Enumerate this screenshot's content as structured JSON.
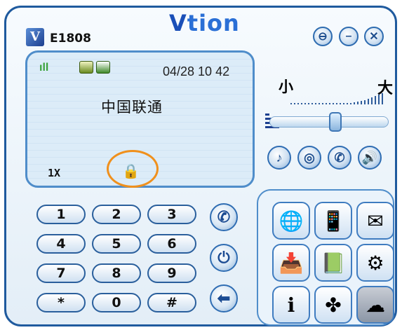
{
  "window": {
    "brand_letter": "V",
    "model": "E1808",
    "logo_prefix": "V",
    "logo_rest": "tion",
    "buttons": {
      "lock": "⊖",
      "minimize": "–",
      "close": "✕"
    }
  },
  "screen": {
    "signal": "ıll",
    "datetime": "04/28 10 42",
    "operator": "中国联通",
    "mode": "1X",
    "lock_glyph": "🔒"
  },
  "volume": {
    "low_label": "小",
    "high_label": "大",
    "level": 0.56
  },
  "function_buttons": [
    "♪",
    "◎",
    "✆",
    "🔊"
  ],
  "keypad": {
    "keys": [
      "1",
      "2",
      "3",
      "4",
      "5",
      "6",
      "7",
      "8",
      "9",
      "*",
      "0",
      "#"
    ]
  },
  "side_buttons": {
    "call": "✆",
    "power": "⏻",
    "back": "⬅"
  },
  "apps": [
    {
      "name": "browser-icon",
      "glyph": "🌐"
    },
    {
      "name": "phone-icon",
      "glyph": "📱"
    },
    {
      "name": "send-mail-icon",
      "glyph": "✉"
    },
    {
      "name": "inbox-icon",
      "glyph": "📥"
    },
    {
      "name": "contacts-book-icon",
      "glyph": "📗"
    },
    {
      "name": "settings-icon",
      "glyph": "⚙"
    },
    {
      "name": "info-icon",
      "glyph": "ℹ"
    },
    {
      "name": "unicom-icon",
      "glyph": "✤"
    },
    {
      "name": "cloud-icon",
      "glyph": "☁"
    }
  ],
  "colors": {
    "accent": "#1f5a9e",
    "logo": "#2a6fd6",
    "highlight": "#f0901c"
  }
}
